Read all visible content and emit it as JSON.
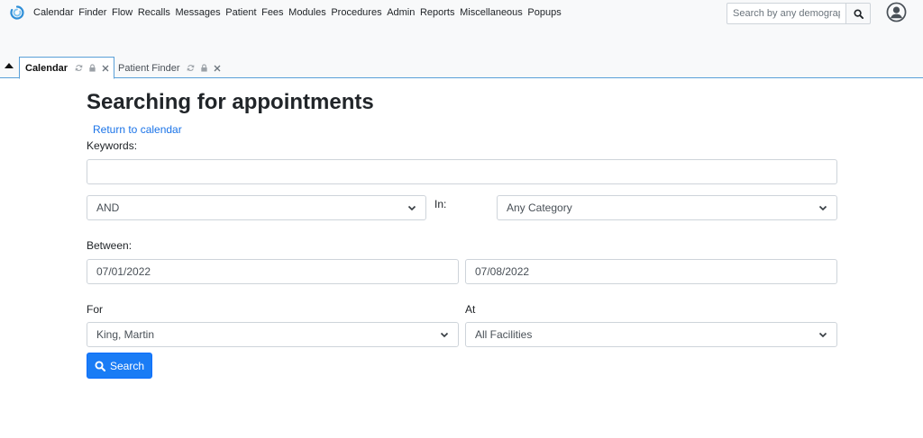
{
  "nav": {
    "menu": [
      "Calendar",
      "Finder",
      "Flow",
      "Recalls",
      "Messages",
      "Patient",
      "Fees",
      "Modules",
      "Procedures",
      "Admin",
      "Reports",
      "Miscellaneous",
      "Popups"
    ],
    "search_placeholder": "Search by any demographics"
  },
  "tabs": [
    {
      "label": "Calendar",
      "active": true
    },
    {
      "label": "Patient Finder",
      "active": false
    }
  ],
  "page": {
    "title": "Searching for appointments",
    "return_link": "Return to calendar"
  },
  "form": {
    "keywords_label": "Keywords:",
    "keywords_value": "",
    "operator": "AND",
    "in_label": "In:",
    "category": "Any Category",
    "between_label": "Between:",
    "date_from": "07/01/2022",
    "date_to": "07/08/2022",
    "for_label": "For",
    "provider": "King, Martin",
    "at_label": "At",
    "facility": "All Facilities",
    "search_button": "Search"
  },
  "colors": {
    "accent": "#1a7cf5",
    "link": "#1a73e8",
    "tab_border": "#5aa0d8"
  }
}
